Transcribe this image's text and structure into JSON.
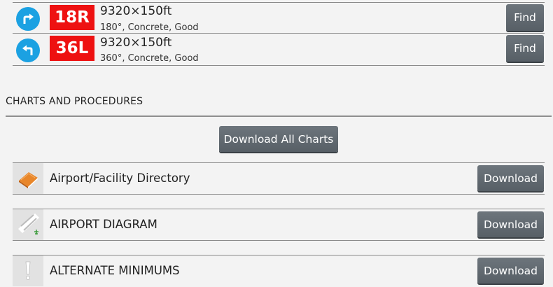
{
  "runways": [
    {
      "id": "18R",
      "dims": "9320×150ft",
      "desc": "180°, Concrete, Good",
      "turn": "right-turn-icon",
      "find_label": "Find"
    },
    {
      "id": "36L",
      "dims": "9320×150ft",
      "desc": "360°, Concrete, Good",
      "turn": "left-turn-icon",
      "find_label": "Find"
    }
  ],
  "charts_section": {
    "title": "CHARTS AND PROCEDURES",
    "download_all_label": "Download All Charts",
    "items": [
      {
        "label": "Airport/Facility Directory",
        "icon": "book-icon",
        "button": "Download"
      },
      {
        "label": "AIRPORT DIAGRAM",
        "icon": "airport-diagram-icon",
        "button": "Download"
      },
      {
        "label": "ALTERNATE MINIMUMS",
        "icon": "exclamation-icon",
        "button": "Download"
      }
    ]
  },
  "colors": {
    "runway_badge": "#ee1111",
    "turn_icon": "#1ba1e2",
    "button": "#61696f"
  }
}
